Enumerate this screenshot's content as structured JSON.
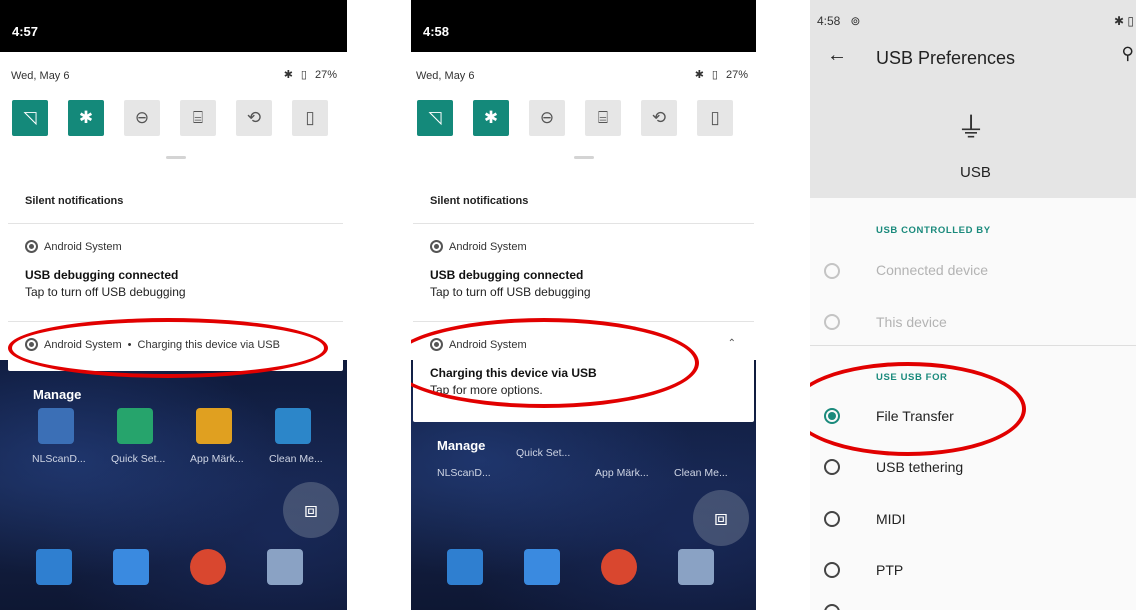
{
  "screen1": {
    "time": "4:57",
    "date": "Wed, May 6",
    "bluetooth_icon": "bluetooth-icon",
    "battery": "27%",
    "silent_header": "Silent notifications",
    "n1_app": "Android System",
    "n1_title": "USB debugging connected",
    "n1_text": "Tap to turn off USB debugging",
    "n2_app": "Android System",
    "n2_sep": "•",
    "n2_text": "Charging this device via USB",
    "manage": "Manage"
  },
  "screen2": {
    "time": "4:58",
    "date": "Wed, May 6",
    "battery": "27%",
    "silent_header": "Silent notifications",
    "n1_app": "Android System",
    "n1_title": "USB debugging connected",
    "n1_text": "Tap to turn off USB debugging",
    "n2_app": "Android System",
    "n2_title": "Charging this device via USB",
    "n2_text": "Tap for more options.",
    "manage": "Manage"
  },
  "apps": [
    "NLScanD...",
    "Quick Set...",
    "App Märk...",
    "Clean Me..."
  ],
  "screen3": {
    "time": "4:58",
    "title": "USB Preferences",
    "usb_label": "USB",
    "section_controlled": "USB CONTROLLED BY",
    "opt_connected": "Connected device",
    "opt_this": "This device",
    "section_use": "USE USB FOR",
    "opt_file": "File Transfer",
    "opt_tether": "USB tethering",
    "opt_midi": "MIDI",
    "opt_ptp": "PTP",
    "selected": "File Transfer"
  },
  "colors": {
    "accent": "#14897a",
    "highlight": "#e10000",
    "homescreen": "#152348"
  }
}
